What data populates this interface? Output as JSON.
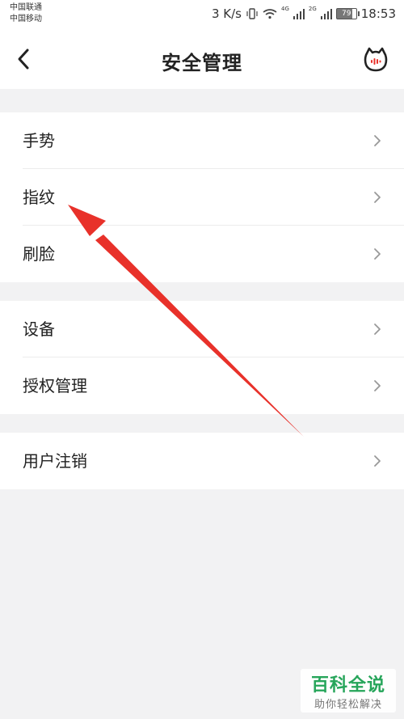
{
  "status_bar": {
    "carrier_1": "中国联通",
    "carrier_2": "中国移动",
    "network_speed": "3 K/s",
    "signal_1_label": "4G",
    "signal_2_label": "2G",
    "battery": "79",
    "time": "18:53"
  },
  "header": {
    "title": "安全管理",
    "back_icon": "back-chevron-icon",
    "service_icon": "customer-service-icon"
  },
  "groups": [
    {
      "items": [
        {
          "label": "手势"
        },
        {
          "label": "指纹"
        },
        {
          "label": "刷脸"
        }
      ]
    },
    {
      "items": [
        {
          "label": "设备"
        },
        {
          "label": "授权管理"
        }
      ]
    },
    {
      "items": [
        {
          "label": "用户注销"
        }
      ]
    }
  ],
  "watermark": {
    "title": "百科全说",
    "subtitle": "助你轻松解决"
  },
  "colors": {
    "background": "#f2f2f3",
    "surface": "#ffffff",
    "annotation_arrow": "#e8312a",
    "watermark_green": "#26a55a"
  }
}
